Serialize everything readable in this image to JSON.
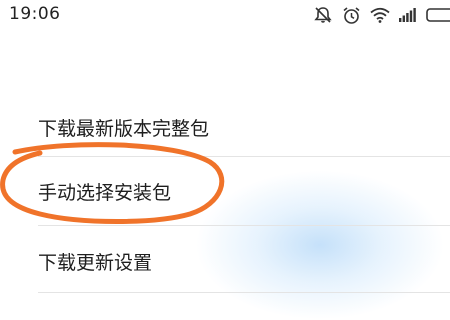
{
  "status_bar": {
    "time": "19:06",
    "icons": [
      "mute-icon",
      "alarm-icon",
      "wifi-icon",
      "signal-icon",
      "battery-icon"
    ]
  },
  "menu": {
    "items": [
      {
        "label": "下载最新版本完整包"
      },
      {
        "label": "手动选择安装包",
        "highlighted": true
      },
      {
        "label": "下载更新设置"
      }
    ]
  },
  "annotation": {
    "color": "#f0732a"
  },
  "colors": {
    "text": "#1e1e1e",
    "divider": "#e4e4e4",
    "background": "#ffffff"
  }
}
